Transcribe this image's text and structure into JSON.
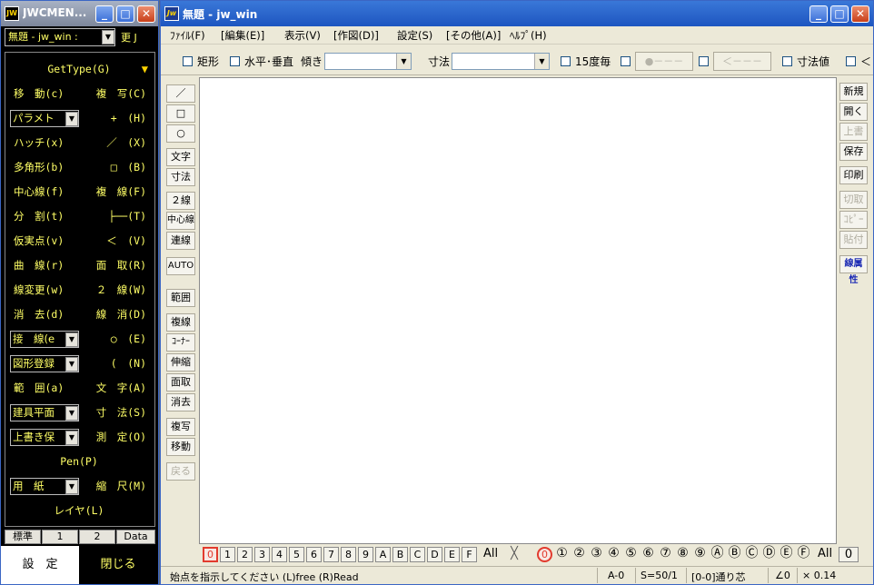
{
  "menu_window": {
    "title": "JWCMEN...",
    "app_icon": "JW",
    "doc_select": "無題 - jw_win :",
    "update_label": "更 J",
    "gettype": "GetType(G)",
    "rows": [
      {
        "l": "移　動(c)",
        "r": "複　写(C)"
      },
      {
        "combo": "パラメト",
        "r": "+　(H)"
      },
      {
        "l": "ハッチ(x)",
        "r": "／　(X)"
      },
      {
        "l": "多角形(b)",
        "r": "□　(B)"
      },
      {
        "l": "中心線(f)",
        "r": "複　線(F)"
      },
      {
        "l": "分　割(t)",
        "r": "├──(T)"
      },
      {
        "l": "仮実点(v)",
        "r": "＜　(V)"
      },
      {
        "l": "曲　線(r)",
        "r": "面　取(R)"
      },
      {
        "l": "線変更(w)",
        "r": "２　線(W)"
      },
      {
        "l": "消　去(d)",
        "r": "線　消(D)"
      },
      {
        "combo": "接　線(e",
        "r": "○　(E)"
      },
      {
        "combo": "図形登録",
        "r": "(　(N)"
      },
      {
        "l": "範　囲(a)",
        "r": "文　字(A)"
      },
      {
        "combo": "建具平面",
        "r": "寸　法(S)"
      },
      {
        "combo": "上書き保",
        "r": "測　定(O)"
      },
      {
        "center": "Pen(P)"
      },
      {
        "combo": "用　紙",
        "r": "縮　尺(M)"
      },
      {
        "center": "レイヤ(L)"
      }
    ],
    "tabs": [
      "標準",
      "1",
      "2",
      "Data"
    ],
    "settings": "設　定",
    "close": "閉じる"
  },
  "main_window": {
    "title": "無題 - jw_win",
    "app_icon": "Jw",
    "menus": [
      "ﾌｧｲﾙ(F)",
      "[編集(E)]",
      "表示(V)",
      "[作図(D)]",
      "設定(S)",
      "[その他(A)]",
      "ﾍﾙﾌﾟ(H)"
    ],
    "toolbar": {
      "rect": "矩形",
      "horiz_vert": "水平･垂直",
      "tilt": "傾き",
      "dim": "寸法",
      "per15": "15度毎",
      "btn_dot": "●－－－",
      "btn_lt": "＜－－－",
      "dim_value": "寸法値",
      "cut": "＜"
    },
    "left_tools": [
      "／",
      "□",
      "○",
      "文字",
      "寸法",
      "２線",
      "中心線",
      "連線",
      "AUTO",
      "範囲",
      "複線",
      "ｺｰﾅｰ",
      "伸縮",
      "面取",
      "消去",
      "複写",
      "移動",
      "戻る"
    ],
    "right_tools": [
      "新規",
      "開く",
      "上書",
      "保存",
      "印刷",
      "切取",
      "ｺﾋﾟｰ",
      "貼付",
      "線属性"
    ],
    "layers": [
      "0",
      "1",
      "2",
      "3",
      "4",
      "5",
      "6",
      "7",
      "8",
      "9",
      "A",
      "B",
      "C",
      "D",
      "E",
      "F"
    ],
    "layer_all": "All",
    "layer_x": "╳",
    "groups": [
      "0",
      "①",
      "②",
      "③",
      "④",
      "⑤",
      "⑥",
      "⑦",
      "⑧",
      "⑨",
      "Ⓐ",
      "Ⓑ",
      "Ⓒ",
      "Ⓓ",
      "Ⓔ",
      "Ⓕ"
    ],
    "group_all": "All",
    "group_current": "0",
    "status": {
      "message": "始点を指示してください (L)free (R)Read",
      "layer": "A-0",
      "scale": "S=50/1",
      "group": "[0-0]通り芯",
      "angle": "∠0",
      "zoom": "× 0.14"
    }
  }
}
